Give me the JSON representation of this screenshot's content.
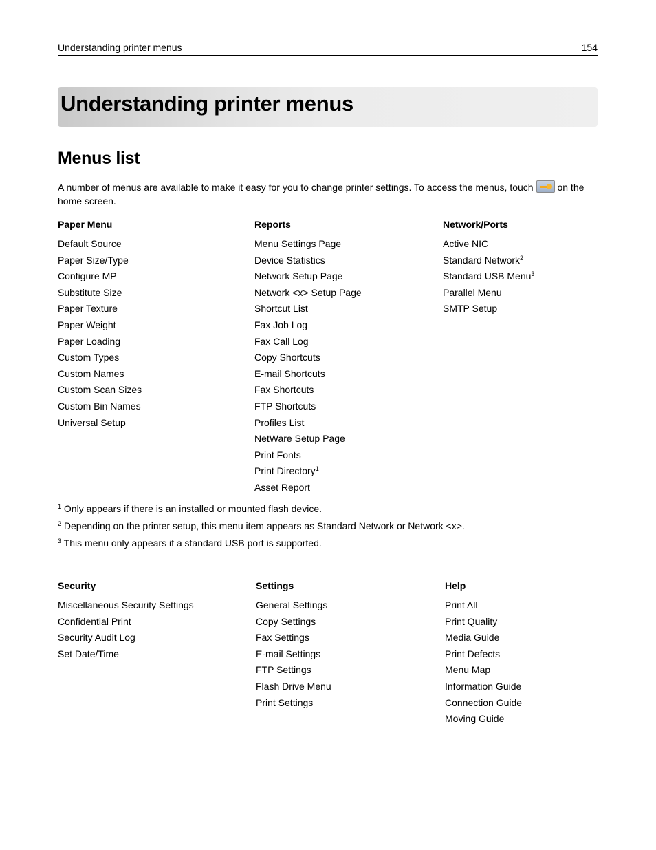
{
  "header": {
    "title": "Understanding printer menus",
    "page_number": "154"
  },
  "chapter_title": "Understanding printer menus",
  "section_title": "Menus list",
  "intro": {
    "text_before": "A number of menus are available to make it easy for you to change printer settings. To access the menus, touch",
    "icon": "home-menu-icon",
    "text_after": "on the home screen."
  },
  "groups_top": [
    {
      "title": "Paper Menu",
      "items": [
        {
          "label": "Default Source"
        },
        {
          "label": "Paper Size/Type"
        },
        {
          "label": "Configure MP"
        },
        {
          "label": "Substitute Size"
        },
        {
          "label": "Paper Texture"
        },
        {
          "label": "Paper Weight"
        },
        {
          "label": "Paper Loading"
        },
        {
          "label": "Custom Types"
        },
        {
          "label": "Custom Names"
        },
        {
          "label": "Custom Scan Sizes"
        },
        {
          "label": "Custom Bin Names"
        },
        {
          "label": "Universal Setup"
        }
      ]
    },
    {
      "title": "Reports",
      "items": [
        {
          "label": "Menu Settings Page"
        },
        {
          "label": "Device Statistics"
        },
        {
          "label": "Network Setup Page"
        },
        {
          "label": "Network <x> Setup Page"
        },
        {
          "label": "Shortcut List"
        },
        {
          "label": "Fax Job Log"
        },
        {
          "label": "Fax Call Log"
        },
        {
          "label": "Copy Shortcuts"
        },
        {
          "label": "E-mail Shortcuts"
        },
        {
          "label": "Fax Shortcuts"
        },
        {
          "label": "FTP Shortcuts"
        },
        {
          "label": "Profiles List"
        },
        {
          "label": "NetWare Setup Page"
        },
        {
          "label": "Print Fonts"
        },
        {
          "label": "Print Directory",
          "sup": "1"
        },
        {
          "label": "Asset Report"
        }
      ]
    },
    {
      "title": "Network/Ports",
      "items": [
        {
          "label": "Active NIC"
        },
        {
          "label": "Standard Network",
          "sup": "2"
        },
        {
          "label": "Standard USB Menu",
          "sup": "3"
        },
        {
          "label": "Parallel Menu"
        },
        {
          "label": "SMTP Setup"
        }
      ]
    }
  ],
  "footnotes": [
    {
      "mark": "1",
      "text": "Only appears if there is an installed or mounted flash device."
    },
    {
      "mark": "2",
      "text": "Depending on the printer setup, this menu item appears as Standard Network or Network <x>."
    },
    {
      "mark": "3",
      "text": "This menu only appears if a standard USB port is supported."
    }
  ],
  "groups_bottom": [
    {
      "title": "Security",
      "items": [
        {
          "label": "Miscellaneous Security Settings"
        },
        {
          "label": "Confidential Print"
        },
        {
          "label": "Security Audit Log"
        },
        {
          "label": "Set Date/Time"
        }
      ]
    },
    {
      "title": "Settings",
      "items": [
        {
          "label": "General Settings"
        },
        {
          "label": "Copy Settings"
        },
        {
          "label": "Fax Settings"
        },
        {
          "label": "E-mail Settings"
        },
        {
          "label": "FTP Settings"
        },
        {
          "label": "Flash Drive Menu"
        },
        {
          "label": "Print Settings"
        }
      ]
    },
    {
      "title": "Help",
      "items": [
        {
          "label": "Print All"
        },
        {
          "label": "Print Quality"
        },
        {
          "label": "Media Guide"
        },
        {
          "label": "Print Defects"
        },
        {
          "label": "Menu Map"
        },
        {
          "label": "Information Guide"
        },
        {
          "label": "Connection Guide"
        },
        {
          "label": "Moving Guide"
        }
      ]
    }
  ]
}
